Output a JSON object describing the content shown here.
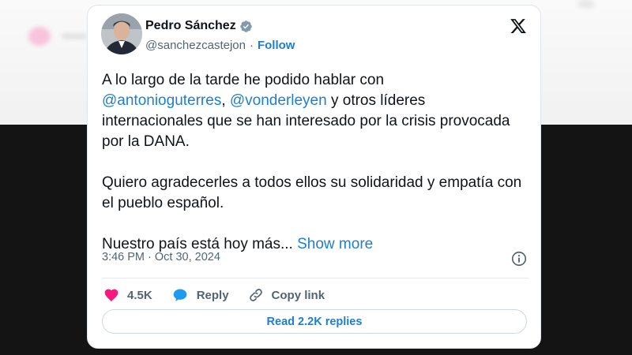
{
  "tweet": {
    "author": {
      "display_name": "Pedro Sánchez",
      "handle": "@sanchezcastejon",
      "separator": "·",
      "follow_label": "Follow"
    },
    "body": {
      "p1_text1": "A lo largo de la tarde he podido hablar con",
      "mention1": "@antonioguterres",
      "comma": ",",
      "mention2": "@vonderleyen",
      "p1_text2": " y otros líderes internacionales que se han interesado por la crisis provocada por la DANA.",
      "p2": "Quiero agradecerles a todos ellos su solidaridad y empatía con el pueblo español.",
      "p3": "Nuestro país está hoy más... ",
      "show_more": "Show more"
    },
    "timestamp": "3:46 PM · Oct 30, 2024",
    "actions": {
      "likes": "4.5K",
      "reply": "Reply",
      "copy_link": "Copy link"
    },
    "read_replies": "Read 2.2K replies"
  },
  "icons": {
    "verified": "verified-badge-icon",
    "brand": "x-logo-icon",
    "info": "info-icon",
    "like": "heart-icon",
    "reply": "reply-bubble-icon",
    "copy": "link-icon"
  },
  "colors": {
    "link": "#1d7fd0",
    "heart": "#f91880",
    "text": "#0f1419",
    "muted": "#536471"
  }
}
